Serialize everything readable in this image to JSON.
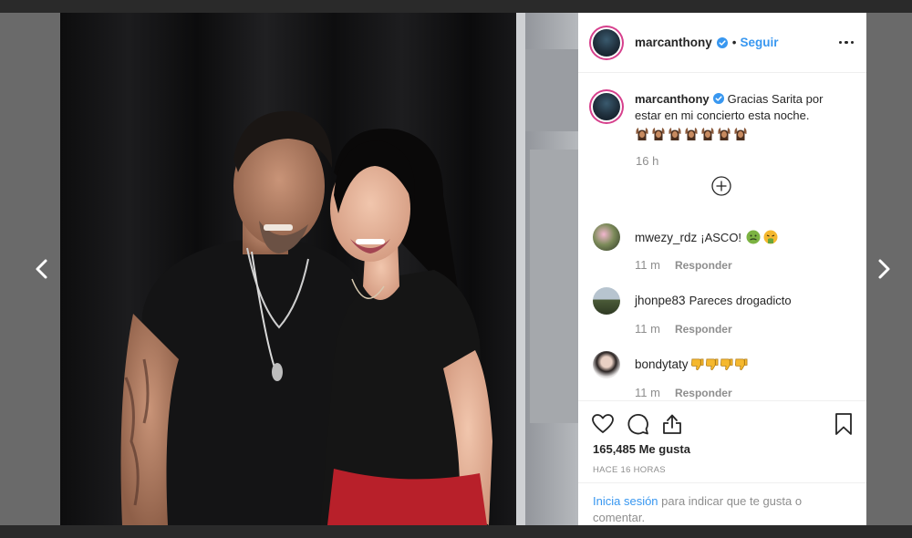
{
  "header": {
    "username": "marcanthony",
    "separator": "•",
    "follow_label": "Seguir"
  },
  "caption": {
    "username": "marcanthony",
    "text": "Gracias Sarita por estar en mi concierto esta noche.",
    "emoji_count": 7,
    "time": "16 h"
  },
  "comments": [
    {
      "username": "mwezy_rdz",
      "text": "¡ASCO!",
      "time": "11 m",
      "reply_label": "Responder",
      "emoji": [
        "nauseated-face-icon",
        "face-vomiting-icon"
      ]
    },
    {
      "username": "jhonpe83",
      "text": "Pareces drogadicto",
      "time": "11 m",
      "reply_label": "Responder",
      "emoji": []
    },
    {
      "username": "bondytaty",
      "text": "",
      "time": "11 m",
      "reply_label": "Responder",
      "emoji": [
        "thumbs-down-icon",
        "thumbs-down-icon",
        "thumbs-down-icon",
        "thumbs-down-icon"
      ]
    }
  ],
  "stats": {
    "likes": "165,485 Me gusta",
    "posted_ago": "HACE 16 HORAS"
  },
  "login_prompt": {
    "link": "Inicia sesión",
    "text": " para indicar que te gusta o comentar."
  },
  "colors": {
    "accent_blue": "#3897f0",
    "text": "#262626",
    "muted": "#8e8e8e",
    "story_ring": "#d63f8c"
  }
}
